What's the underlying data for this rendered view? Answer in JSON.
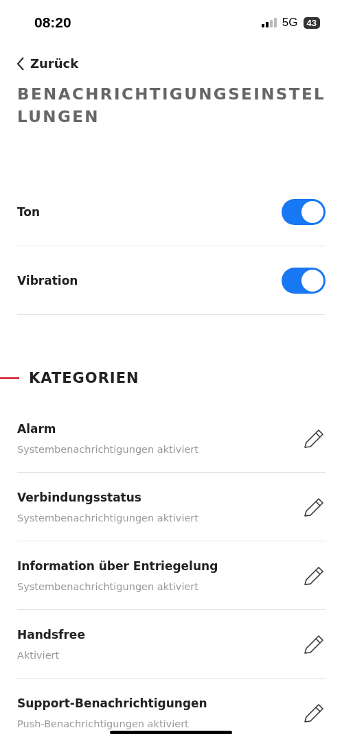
{
  "status_bar": {
    "time": "08:20",
    "network": "5G",
    "battery": "43"
  },
  "back": {
    "label": "Zurück"
  },
  "title": "BENACHRICHTIGUNGSEINSTELLUNGEN",
  "toggles": [
    {
      "label": "Ton",
      "on": true
    },
    {
      "label": "Vibration",
      "on": true
    }
  ],
  "section": {
    "title": "KATEGORIEN"
  },
  "categories": [
    {
      "title": "Alarm",
      "subtitle": "Systembenachrichtigungen aktiviert"
    },
    {
      "title": "Verbindungsstatus",
      "subtitle": "Systembenachrichtigungen aktiviert"
    },
    {
      "title": "Information über Entriegelung",
      "subtitle": "Systembenachrichtigungen aktiviert"
    },
    {
      "title": "Handsfree",
      "subtitle": "Aktiviert"
    },
    {
      "title": "Support-Benachrichtigungen",
      "subtitle": "Push-Benachrichtigungen aktiviert"
    }
  ]
}
